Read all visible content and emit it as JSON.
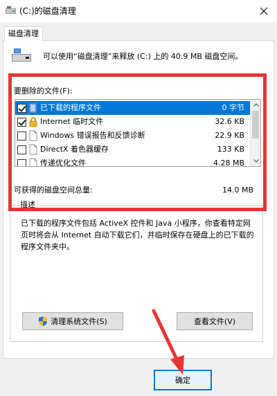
{
  "window": {
    "title": "(C:)的磁盘清理",
    "close_glyph": "✕"
  },
  "tab": {
    "label": "磁盘清理"
  },
  "header": {
    "text": "可以使用“磁盘清理”来释放  (C:) 上的 40.9 MB 磁盘空间。"
  },
  "files": {
    "label": "要删除的文件(F):",
    "items": [
      {
        "name": "已下载的程序文件",
        "size": "0 字节",
        "checked": true,
        "selected": true
      },
      {
        "name": "Internet 临时文件",
        "size": "32.6 KB",
        "checked": true,
        "selected": false
      },
      {
        "name": "Windows 错误报告和反馈诊断",
        "size": "22.9 KB",
        "checked": false,
        "selected": false
      },
      {
        "name": "DirectX 着色器缓存",
        "size": "133 KB",
        "checked": false,
        "selected": false
      },
      {
        "name": "传递优化文件",
        "size": "4.28 MB",
        "checked": false,
        "selected": false
      }
    ]
  },
  "total": {
    "label": "可获得的磁盘空间总量:",
    "value": "14.0 MB"
  },
  "description": {
    "title": "描述",
    "text": "已下载的程序文件包括 ActiveX 控件和 Java 小程序，你查看特定网页时将会从 Internet 自动下载它们，并临时保存在硬盘上的已下载的程序文件夹中。"
  },
  "buttons": {
    "clean_system": "清理系统文件(S)",
    "view_files": "查看文件(V)",
    "ok": "确定"
  },
  "colors": {
    "accent": "#0078d7",
    "annotation": "#e63535"
  }
}
